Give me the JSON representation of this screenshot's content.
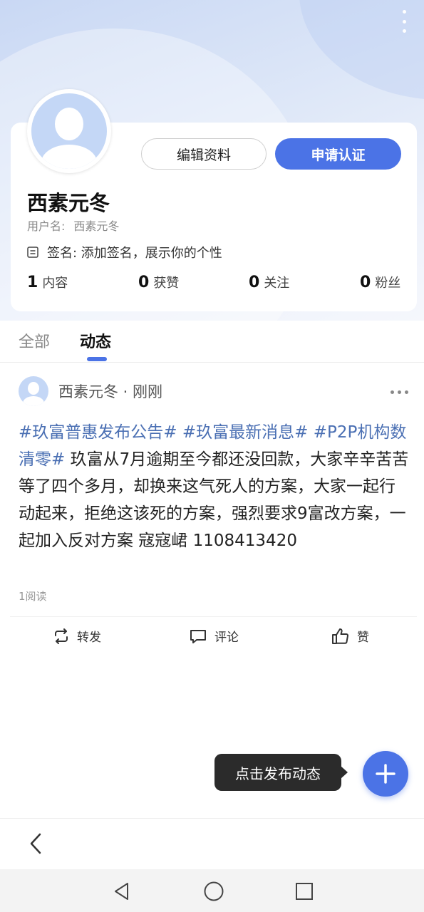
{
  "header": {
    "more_icon": "more-vertical-icon"
  },
  "profile": {
    "edit_label": "编辑资料",
    "apply_label": "申请认证",
    "nickname": "西素元冬",
    "username_label": "用户名:",
    "username": "西素元冬",
    "signature_label": "签名",
    "signature_text": ": 添加签名，展示你的个性",
    "stats": [
      {
        "num": "1",
        "label": "内容"
      },
      {
        "num": "0",
        "label": "获赞"
      },
      {
        "num": "0",
        "label": "关注"
      },
      {
        "num": "0",
        "label": "粉丝"
      }
    ]
  },
  "tabs": {
    "all": "全部",
    "dynamic": "动态"
  },
  "post": {
    "author_line": "西素元冬 · 刚刚",
    "tags": [
      "#玖富普惠发布公告#",
      "#玖富最新消息#",
      "#P2P机构数清零#"
    ],
    "body": " 玖富从7月逾期至今都还没回款，大家辛辛苦苦等了四个多月，却换来这气死人的方案，大家一起行动起来，拒绝这该死的方案，强烈要求9富改方案，一起加入反对方案 寇寇峮 1108413420",
    "reads": "1阅读",
    "actions": {
      "repost": "转发",
      "comment": "评论",
      "like": "赞"
    }
  },
  "tooltip": "点击发布动态",
  "colors": {
    "accent": "#4b73e6",
    "tag": "#4a6fb3",
    "tooltip_bg": "#2b2b2b"
  }
}
